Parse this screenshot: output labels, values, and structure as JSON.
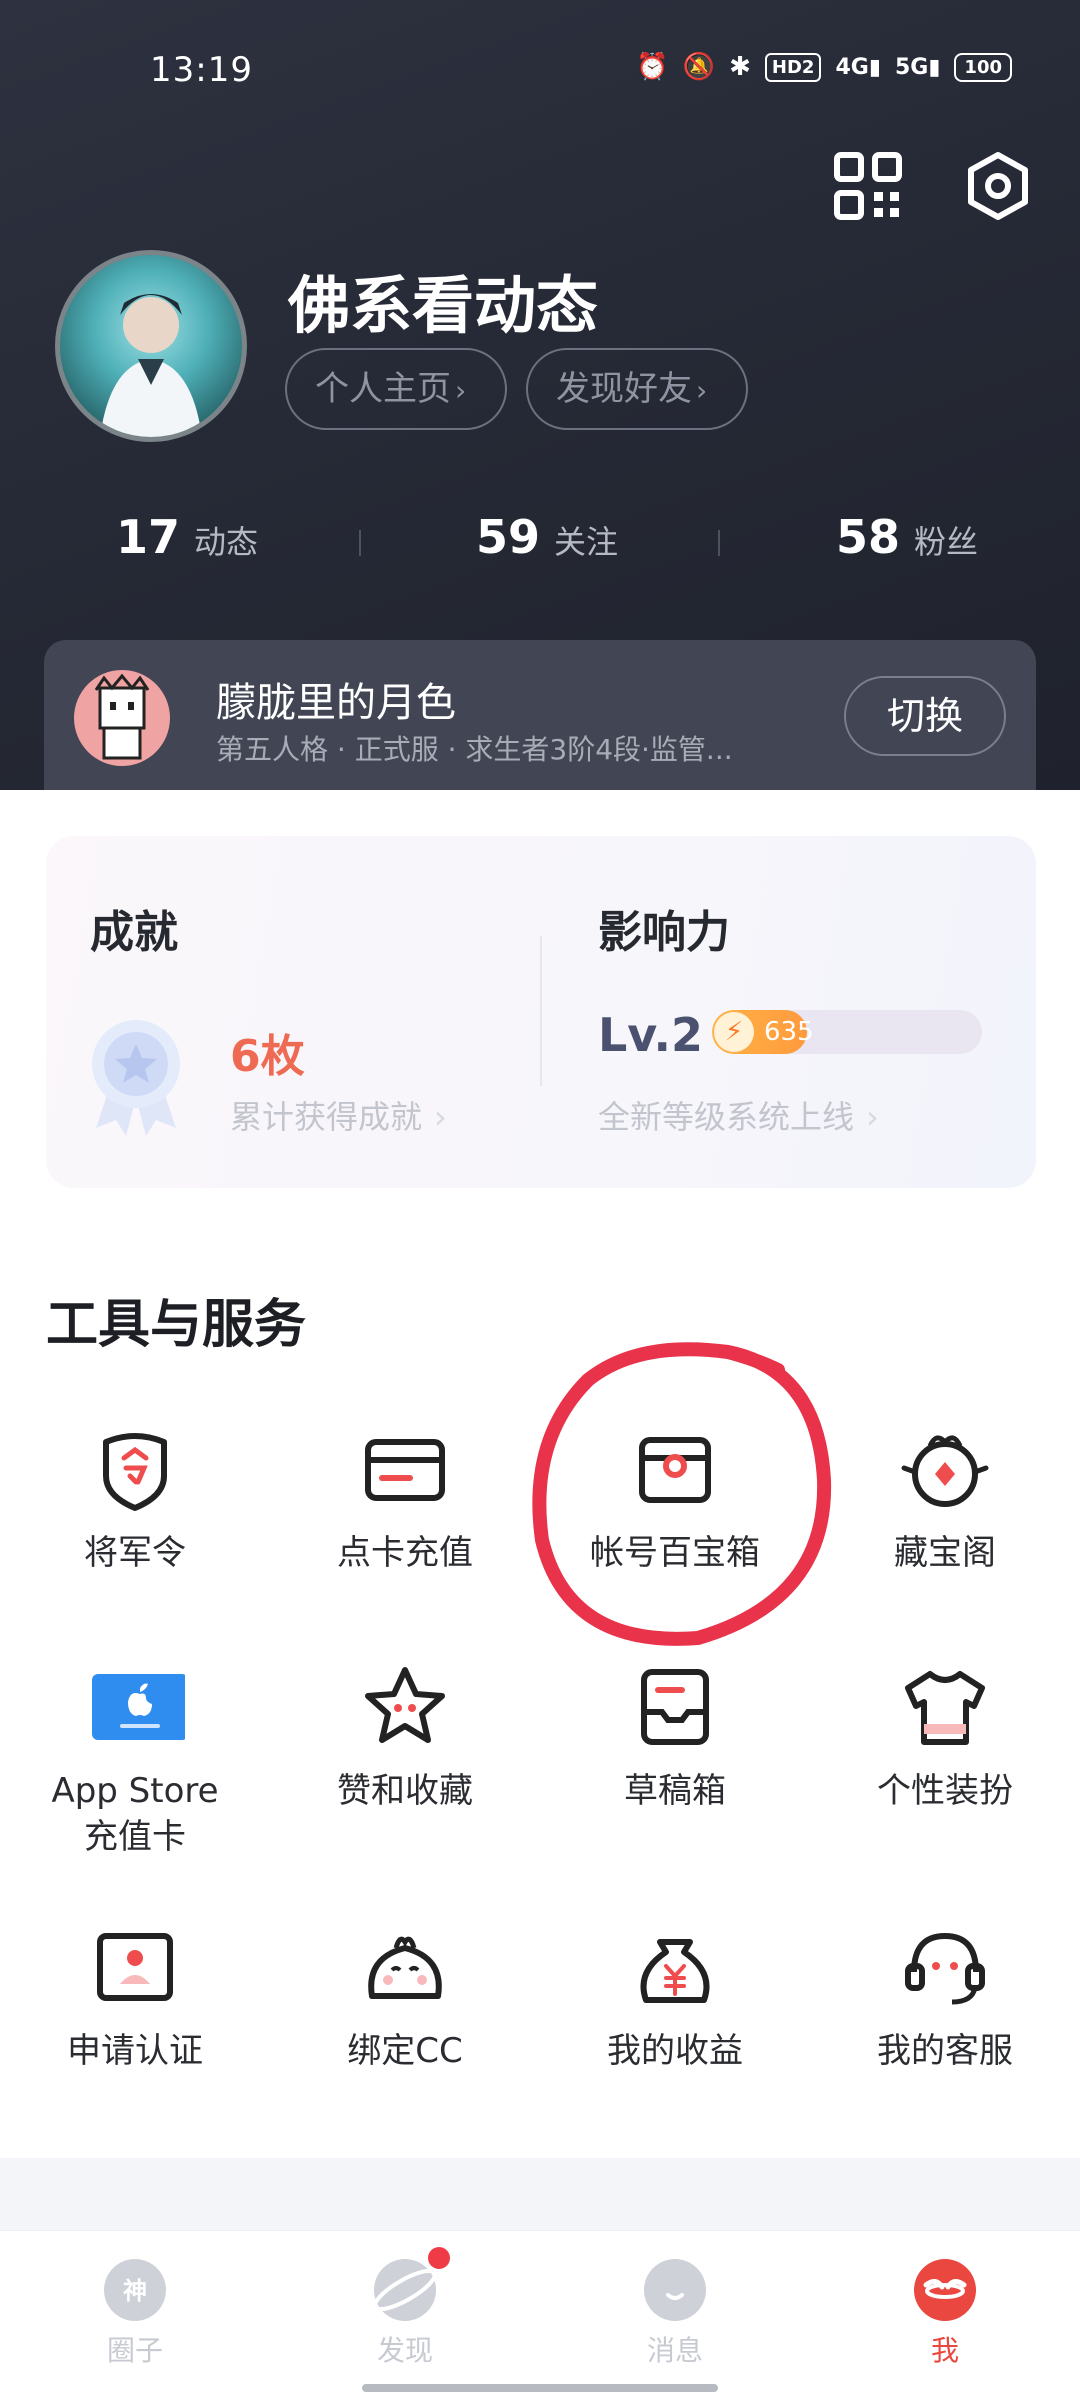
{
  "status_bar": {
    "time": "13:19",
    "hd": "HD2",
    "net1": "4G",
    "net2": "5G",
    "battery": "100"
  },
  "profile": {
    "username": "佛系看动态",
    "homepage_label": "个人主页",
    "find_friends_label": "发现好友",
    "stats": [
      {
        "count": "17",
        "label": "动态"
      },
      {
        "count": "59",
        "label": "关注"
      },
      {
        "count": "58",
        "label": "粉丝"
      }
    ]
  },
  "game_role": {
    "name": "朦胧里的月色",
    "description": "第五人格 · 正式服 · 求生者3阶4段·监管...",
    "switch_label": "切换"
  },
  "achievement": {
    "title": "成就",
    "count": "6枚",
    "subtitle": "累计获得成就"
  },
  "influence": {
    "title": "影响力",
    "level": "Lv.2",
    "points": "635",
    "progress_fraction": 0.35,
    "subtitle": "全新等级系统上线"
  },
  "tools": {
    "title": "工具与服务",
    "items": [
      {
        "label": "将军令",
        "icon": "token-shield-icon"
      },
      {
        "label": "点卡充值",
        "icon": "card-icon"
      },
      {
        "label": "帐号百宝箱",
        "icon": "treasure-box-icon"
      },
      {
        "label": "藏宝阁",
        "icon": "treasure-pavilion-icon"
      },
      {
        "label": "App Store\n充值卡",
        "icon": "app-store-icon"
      },
      {
        "label": "赞和收藏",
        "icon": "star-icon"
      },
      {
        "label": "草稿箱",
        "icon": "draft-box-icon"
      },
      {
        "label": "个性装扮",
        "icon": "shirt-icon"
      },
      {
        "label": "申请认证",
        "icon": "certify-icon"
      },
      {
        "label": "绑定CC",
        "icon": "cc-bun-icon"
      },
      {
        "label": "我的收益",
        "icon": "money-bag-icon"
      },
      {
        "label": "我的客服",
        "icon": "headset-icon"
      }
    ]
  },
  "tabs": [
    {
      "label": "圈子",
      "icon": "circle-god-icon"
    },
    {
      "label": "发现",
      "icon": "planet-icon"
    },
    {
      "label": "消息",
      "icon": "message-icon"
    },
    {
      "label": "我",
      "icon": "me-icon"
    }
  ],
  "colors": {
    "accent": "#e9473f",
    "header_bg": "#262a36",
    "annotation_circle": "#e8334a"
  }
}
